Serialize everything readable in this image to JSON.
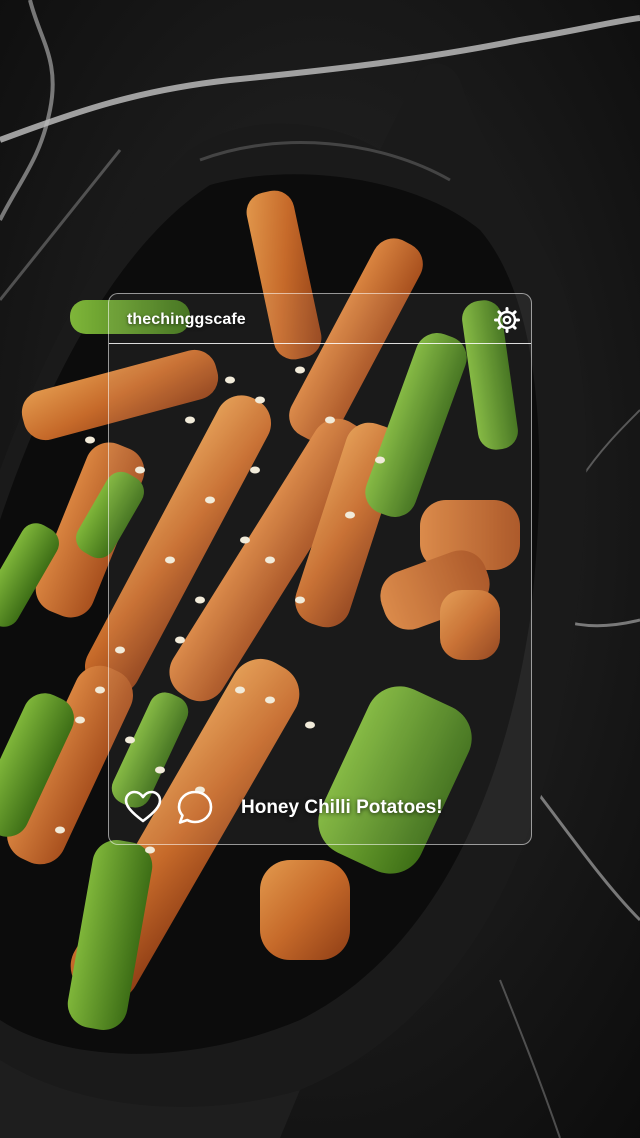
{
  "post": {
    "username": "thechinggscafe",
    "caption": "Honey Chilli Potatoes!"
  },
  "icons": {
    "settings": "gear-icon",
    "like": "heart-icon",
    "comment": "comment-icon"
  },
  "colors": {
    "overlay_text": "#ffffff",
    "background": "#0d0d0d"
  }
}
